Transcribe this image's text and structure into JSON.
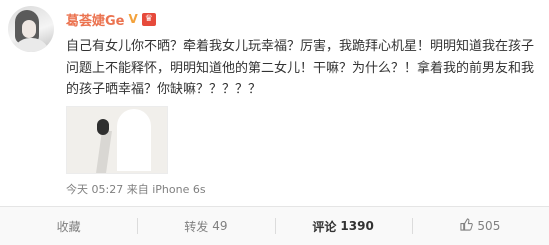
{
  "post": {
    "author": "葛荟婕Ge",
    "badge_vip": "V",
    "badge_member": "♛",
    "text": "自己有女儿你不晒？牵着我女儿玩幸福？厉害，我跪拜心机星！明明知道我在孩子问题上不能释怀，明明知道他的第二女儿！干嘛？为什么？！拿着我的前男友和我的孩子晒幸福？你缺嘛？？？？？",
    "time": "今天 05:27",
    "source_prefix": "来自",
    "source": "iPhone 6s"
  },
  "actions": {
    "favorite": "收藏",
    "repost_label": "转发",
    "repost_count": "49",
    "comment_label": "评论",
    "comment_count": "1390",
    "like_count": "505"
  },
  "colors": {
    "username": "#eb7350",
    "vip": "#f3a23c",
    "member_badge": "#e64a3b",
    "meta": "#808080"
  }
}
